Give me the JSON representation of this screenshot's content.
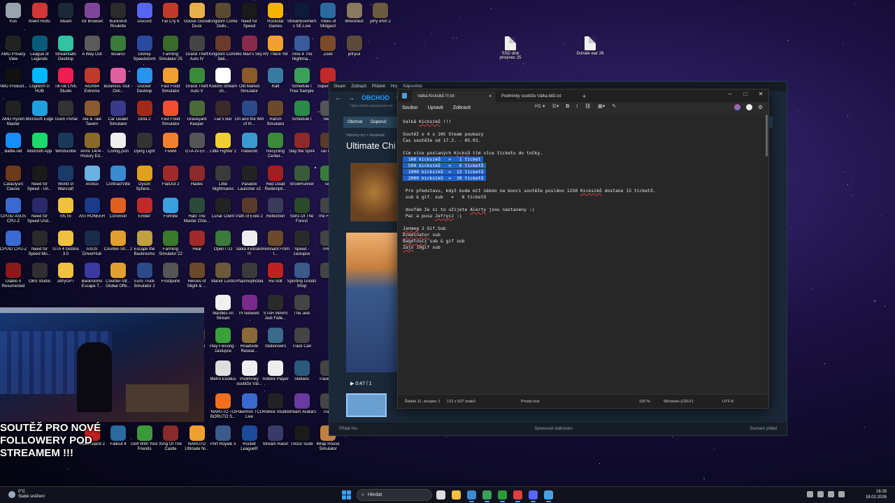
{
  "desktop": {
    "icons": [
      {
        "label": "Koš",
        "color": "#9aa3ad"
      },
      {
        "label": "Klient Riotu",
        "color": "#d13639"
      },
      {
        "label": "Steam",
        "color": "#1b2838"
      },
      {
        "label": "Tor Browser",
        "color": "#7d4698"
      },
      {
        "label": "Buckshot Roulette",
        "color": "#2b2b2b"
      },
      {
        "label": "Discord",
        "color": "#5865f2"
      },
      {
        "label": "Far Cry 6",
        "color": "#c0392b"
      },
      {
        "label": "Goose Goose Duck",
        "color": "#e8b04a"
      },
      {
        "label": "Kingdom Come Deliv...",
        "color": "#5a4a30"
      },
      {
        "label": "Need for Speed",
        "color": "#1a1a1a"
      },
      {
        "label": "Rockstar Games",
        "color": "#f4b400"
      },
      {
        "label": "StreamElements SE.Live",
        "color": "#0e1a3a"
      },
      {
        "label": "Tribes of Midgard",
        "color": "#2a6aa0"
      },
      {
        "label": "Wreckfest",
        "color": "#8a7a60"
      },
      {
        "label": "jefry ehm 2",
        "color": "#6a5a40"
      },
      {
        "label": "AMD Privacy View",
        "color": "#222"
      },
      {
        "label": "League of Legends",
        "color": "#0a5a7a"
      },
      {
        "label": "Streamlabs Desktop",
        "color": "#31c3a2"
      },
      {
        "label": "A Way Out",
        "color": "#5a5a5a"
      },
      {
        "label": "Bulanci",
        "color": "#3a7a3a"
      },
      {
        "label": "Disney Speedstorm",
        "color": "#2a4aa0"
      },
      {
        "label": "Farming Simulator 25",
        "color": "#3a6a2a"
      },
      {
        "label": "Grand Theft Auto IV",
        "color": "#444"
      },
      {
        "label": "Kingdom Come Deli...",
        "color": "#6a3a2a"
      },
      {
        "label": "No Man's Sky",
        "color": "#8a2a4a"
      },
      {
        "label": "RV There Yet",
        "color": "#f0a030"
      },
      {
        "label": "Trine 4 The Nightma...",
        "color": "#3a5a9a"
      },
      {
        "label": "Zoeti",
        "color": "#7a4a2a"
      },
      {
        "label": "jefryiul",
        "color": "#5a4a3a"
      },
      {
        "label": "AMD Product...",
        "color": "#111"
      },
      {
        "label": "Logitech G HUB",
        "color": "#00b8fc"
      },
      {
        "label": "TikTok LIVE Studio",
        "color": "#ee1d52"
      },
      {
        "label": "AIDA64 Extreme",
        "color": "#c0392b"
      },
      {
        "label": "Business Tour - Onli...",
        "color": "#e060a0"
      },
      {
        "label": "Docker Desktop",
        "color": "#2496ed"
      },
      {
        "label": "Fast Food Simulator",
        "color": "#f0a030"
      },
      {
        "label": "Grand Theft Auto V",
        "color": "#3a8a3a"
      },
      {
        "label": "Kukoro Stream ch...",
        "color": "#fff"
      },
      {
        "label": "Old Market Simulator",
        "color": "#8a5a2a"
      },
      {
        "label": "Raft",
        "color": "#3a7aa0"
      },
      {
        "label": "Schedule I Free Sample",
        "color": "#3aa05a"
      },
      {
        "label": "Super Toge",
        "color": "#c02a2a"
      },
      {
        "label": "AMD Ryzen Master",
        "color": "#222"
      },
      {
        "label": "Microsoft Edge",
        "color": "#1fa0e0"
      },
      {
        "label": "Touch Portal",
        "color": "#333"
      },
      {
        "label": "Ale & Tale Tavern",
        "color": "#8a5a30"
      },
      {
        "label": "Car Dealer Simulator",
        "color": "#3a3a8a"
      },
      {
        "label": "Dota 2",
        "color": "#a02a1a"
      },
      {
        "label": "Fast Food Simulator",
        "color": "#f05030"
      },
      {
        "label": "Graveyard Keeper",
        "color": "#4a6a3a"
      },
      {
        "label": "Liar's Bar",
        "color": "#3a2a2a"
      },
      {
        "label": "Ori and the Will of th...",
        "color": "#2a4a8a"
      },
      {
        "label": "Ranch Simulator",
        "color": "#6a4a2a"
      },
      {
        "label": "Schedule I",
        "color": "#2a8a4a"
      },
      {
        "label": "Swor",
        "color": "#555"
      },
      {
        "label": "Battle.net",
        "color": "#148eff"
      },
      {
        "label": "Modrinth App",
        "color": "#1bd96a"
      },
      {
        "label": "Windscribe",
        "color": "#1a3a5a"
      },
      {
        "label": "Anno 1404 - History Ed...",
        "color": "#8a6a2a"
      },
      {
        "label": "Config.json",
        "color": "#eee"
      },
      {
        "label": "Dying Light",
        "color": "#333"
      },
      {
        "label": "FiveM",
        "color": "#f08030"
      },
      {
        "label": "GTA-IV-EF...",
        "color": "#555"
      },
      {
        "label": "Little Fighter 2",
        "color": "#f0d030"
      },
      {
        "label": "Palworld",
        "color": "#3a9ad0"
      },
      {
        "label": "Recycling Center...",
        "color": "#3a8a3a"
      },
      {
        "label": "Slay the Spire",
        "color": "#8a2a2a"
      },
      {
        "label": "Tav Mas",
        "color": "#5a3a2a"
      },
      {
        "label": "Cataclysm Classic",
        "color": "#6a3a1a"
      },
      {
        "label": "Need for Speed - Un...",
        "color": "#1a1a1a"
      },
      {
        "label": "World of Warcraft",
        "color": "#1a3a6a"
      },
      {
        "label": "Arctico",
        "color": "#6ab0e0"
      },
      {
        "label": "ContractVille",
        "color": "#3a8ad0"
      },
      {
        "label": "Dyson Sphere...",
        "color": "#e0a020"
      },
      {
        "label": "FlatOut 2",
        "color": "#a02a2a"
      },
      {
        "label": "Hades",
        "color": "#8a2a2a"
      },
      {
        "label": "Little Nightmares",
        "color": "#3a3a3a"
      },
      {
        "label": "Paradox Launcher v2",
        "color": "#222"
      },
      {
        "label": "Red Dead Redempti...",
        "color": "#a02020"
      },
      {
        "label": "SnowRunner",
        "color": "#3a5a3a"
      },
      {
        "label": "Terr",
        "color": "#3a7a3a"
      },
      {
        "label": "CPUID ASUS CPU-Z",
        "color": "#3a6ad0"
      },
      {
        "label": "Need for Speed Und...",
        "color": "#2a2a6a"
      },
      {
        "label": "nfs fix",
        "color": "#f0c040"
      },
      {
        "label": "ASTRONEER",
        "color": "#1a3a8a"
      },
      {
        "label": "Coromon",
        "color": "#e06020"
      },
      {
        "label": "Ember",
        "color": "#c02a2a"
      },
      {
        "label": "Fortnite",
        "color": "#3aa0e0"
      },
      {
        "label": "Halo The Master Chie...",
        "color": "#2a4a3a"
      },
      {
        "label": "Lunar Client",
        "color": "#222"
      },
      {
        "label": "Path of Exile 2",
        "color": "#5a3a2a"
      },
      {
        "label": "Reflection",
        "color": "#3a3a5a"
      },
      {
        "label": "Sons Of The Forest",
        "color": "#2a4a2a"
      },
      {
        "label": "The F Shel",
        "color": "#444"
      },
      {
        "label": "CPUID CPU-Z",
        "color": "#3a6ad0"
      },
      {
        "label": "Need for Speed Mo...",
        "color": "#2a2a2a"
      },
      {
        "label": "GTA 4 čeština 3.0",
        "color": "#f0c040"
      },
      {
        "label": "ASUS DriverHub",
        "color": "#1a2a4a"
      },
      {
        "label": "Counter-Str... 2",
        "color": "#e0a030"
      },
      {
        "label": "Escape the Backrooms",
        "color": "#c0a040"
      },
      {
        "label": "Farming Simulator 22",
        "color": "#3a7a2a"
      },
      {
        "label": "Heal",
        "color": "#a02a2a"
      },
      {
        "label": "OpenTTD",
        "color": "#3a7a3a"
      },
      {
        "label": "Valká Kicksiků !!!",
        "color": "#eee"
      },
      {
        "label": "Remnant From t...",
        "color": "#6a4a2a"
      },
      {
        "label": "Speed - zastupce",
        "color": "#2a2a2a"
      },
      {
        "label": "THE F",
        "color": "#444"
      },
      {
        "label": "Diablo II Resurrected",
        "color": "#8a1a1a"
      },
      {
        "label": "OBS Studio",
        "color": "#302e31"
      },
      {
        "label": "JefryGPT",
        "color": "#f0c040"
      },
      {
        "label": "Backrooms Escape T...",
        "color": "#3a3aa0"
      },
      {
        "label": "Counter-Str... Global Offe...",
        "color": "#e0a030"
      },
      {
        "label": "Euro Truck Simulator 2",
        "color": "#2a4a8a"
      },
      {
        "label": "Frostpunk",
        "color": "#555"
      },
      {
        "label": "Heroes of Might & ...",
        "color": "#6a4a2a"
      },
      {
        "label": "Manor Lords",
        "color": "#6a5a3a"
      },
      {
        "label": "Phasmophobia",
        "color": "#3a3a3a"
      },
      {
        "label": "Re-Volt",
        "color": "#c02020"
      },
      {
        "label": "Sporting Goods Shop",
        "color": "#3a5a8a"
      },
      {
        "label": "",
        "color": "#444"
      }
    ],
    "col2_icons": [
      {
        "label": "Marbles on Stream",
        "color": "#f0f0f0"
      },
      {
        "label": "Pi Network",
        "color": "#7a2a8a"
      },
      {
        "label": "STAR WARS Jedi Falle...",
        "color": "#2a2a2a"
      },
      {
        "label": "The Jedi",
        "color": "#444"
      },
      {
        "label": "Medieval Dynasty",
        "color": "#5a4a2a"
      },
      {
        "label": "Play Felsóng - zastupce",
        "color": "#3aa03a"
      },
      {
        "label": "Roadside Resear...",
        "color": "#8a6a3a"
      },
      {
        "label": "Stationeers",
        "color": "#3a6a8a"
      },
      {
        "label": "Track Cari",
        "color": "#444"
      },
      {
        "label": "Metro Exodus",
        "color": "#ddd"
      },
      {
        "label": "Podmínky soutěže Vál...",
        "color": "#eee"
      },
      {
        "label": "Roblox Player",
        "color": "#eee"
      },
      {
        "label": "Stellaris",
        "color": "#2a5a7a"
      },
      {
        "label": "Track Nat",
        "color": "#444"
      },
      {
        "label": "NARUTO TO BORUTO S...",
        "color": "#f07020"
      },
      {
        "label": "Pokémon TCG Live",
        "color": "#3a6ad0"
      },
      {
        "label": "Roblox Studio",
        "color": "#222"
      },
      {
        "label": "Stream Avatars",
        "color": "#6a3aa0"
      },
      {
        "label": "Track",
        "color": "#444"
      },
      {
        "label": "Dead Island 2",
        "color": "#c02020"
      },
      {
        "label": "Fallout 4",
        "color": "#2a6aa0"
      },
      {
        "label": "Golf With Your Friends",
        "color": "#3a9a3a"
      },
      {
        "label": "King Of The Castle",
        "color": "#8a2a2a"
      },
      {
        "label": "NARUTO Ultimate Ni...",
        "color": "#f0a030"
      },
      {
        "label": "Port Royale 3",
        "color": "#3a5a8a"
      },
      {
        "label": "Rocket League®",
        "color": "#1a4a9a"
      },
      {
        "label": "Stream Racer",
        "color": "#3a3a6a"
      },
      {
        "label": "Trezor Suite",
        "color": "#1a1a1a"
      },
      {
        "label": "Wrap House Simulator",
        "color": "#c08040"
      }
    ],
    "files": [
      {
        "label": "SSD disk prosinec 25"
      },
      {
        "label": "Donate war 26"
      }
    ]
  },
  "webcam": {
    "overlay_text": "SOUTĚŽ PRO NOVÉ FOLLOWERY POD STREAMEM !!!"
  },
  "steam": {
    "topbar": [
      "Steam",
      "Zobrazit",
      "Přátelé",
      "Hry",
      "Nápověda"
    ],
    "nav": {
      "active": "OBCHOD",
      "next": "KN"
    },
    "url": "https://store.steampowered...",
    "storebar": [
      "Obchod",
      "Doporuč"
    ],
    "breadcrumb": "Všechny hry > Nezávislé",
    "game_title": "Ultimate Chi",
    "player_time": "0:47 / 1",
    "bottom_left": "Přidat hru",
    "bottom_mid": "Spravovat stahování",
    "bottom_right": "Seznam přátel"
  },
  "notepad": {
    "tabs": [
      {
        "title": "Valká Kicksiků !!!.txt",
        "active": true
      },
      {
        "title": "Podmínky soutěže Válka bitů.txt",
        "active": false
      }
    ],
    "menu": [
      "Soubor",
      "Upravit",
      "Zobrazit"
    ],
    "heading_select": "H1",
    "lines": [
      "Valká Kicksiků !!!",
      "",
      "Soutěž o 4 x 10€ Steam poukazy",
      "Čas soutěže od 17.2. - 05.03.",
      "",
      "čím více poslaných Kicksů tím více ticketu do točky.",
      "  100 kicksiků   =   1 ticket ",
      "  500 kicksiků   =   6 ticketů ",
      "  1000 kicksiků  =  13 ticketů ",
      "  2000 kicksiků  =  30 ticketů ",
      "",
      " Pro představu, když bude mít někdo na konci soutěže posláno 1250 Kicksiků dostane 15 ticketů.",
      " sub & gif. sub   =   6 ticketů",
      "",
      " doufám že si to užijete Alerty jsou nastaveny :)",
      " Pac a pusu Jefrycz :)",
      "",
      "Janmeg 2 Gif.Sub",
      "Dzeminator sub",
      "Bagetoscz sub & gif sub",
      "Zajo 10gif sub"
    ],
    "highlighted_lines": [
      6,
      7,
      8,
      9
    ],
    "status": {
      "position": "Řádek 11, sloupec 1",
      "chars": "122 z 537 znaků",
      "format": "Prostý text",
      "zoom": "100 %",
      "eol": "Windows (CRLF)",
      "encoding": "UTF-8"
    }
  },
  "taskbar": {
    "weather_temp": "0°C",
    "weather_desc": "Slabé sněžení",
    "search_placeholder": "Hledat",
    "time": "16:28",
    "date": "18.02.2026",
    "apps": [
      "#ddd",
      "#f0c040",
      "#3a8ad0",
      "#3aa05a",
      "#2a9a3a",
      "#e04040",
      "#5865f2",
      "#4aa0e0"
    ]
  }
}
